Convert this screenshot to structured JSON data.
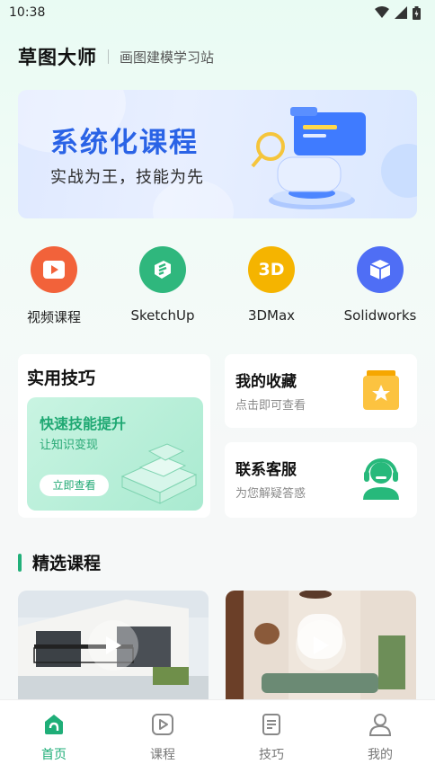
{
  "status": {
    "time": "10:38"
  },
  "header": {
    "title": "草图大师",
    "subtitle": "画图建模学习站"
  },
  "banner": {
    "title": "系统化课程",
    "subtitle": "实战为王，技能为先"
  },
  "categories": [
    {
      "label": "视频课程",
      "icon": "video-play-icon",
      "color": "#f2623a"
    },
    {
      "label": "SketchUp",
      "icon": "sketchup-logo-icon",
      "color": "#2fb77d"
    },
    {
      "label": "3DMax",
      "icon": "3dmax-logo-icon",
      "color": "#f5b400"
    },
    {
      "label": "Solidworks",
      "icon": "cube-icon",
      "color": "#4f6ef5"
    }
  ],
  "tips": {
    "title": "实用技巧",
    "promo_title": "快速技能提升",
    "promo_sub": "让知识变现",
    "button": "立即查看"
  },
  "favorites": {
    "title": "我的收藏",
    "sub": "点击即可查看"
  },
  "service": {
    "title": "联系客服",
    "sub": "为您解疑答惑"
  },
  "featured": {
    "title": "精选课程"
  },
  "nav": [
    {
      "label": "首页",
      "icon": "home-icon",
      "active": true
    },
    {
      "label": "课程",
      "icon": "course-play-icon",
      "active": false
    },
    {
      "label": "技巧",
      "icon": "document-icon",
      "active": false
    },
    {
      "label": "我的",
      "icon": "user-icon",
      "active": false
    }
  ],
  "colors": {
    "accent": "#1fae78",
    "banner_title": "#2a63e6"
  }
}
